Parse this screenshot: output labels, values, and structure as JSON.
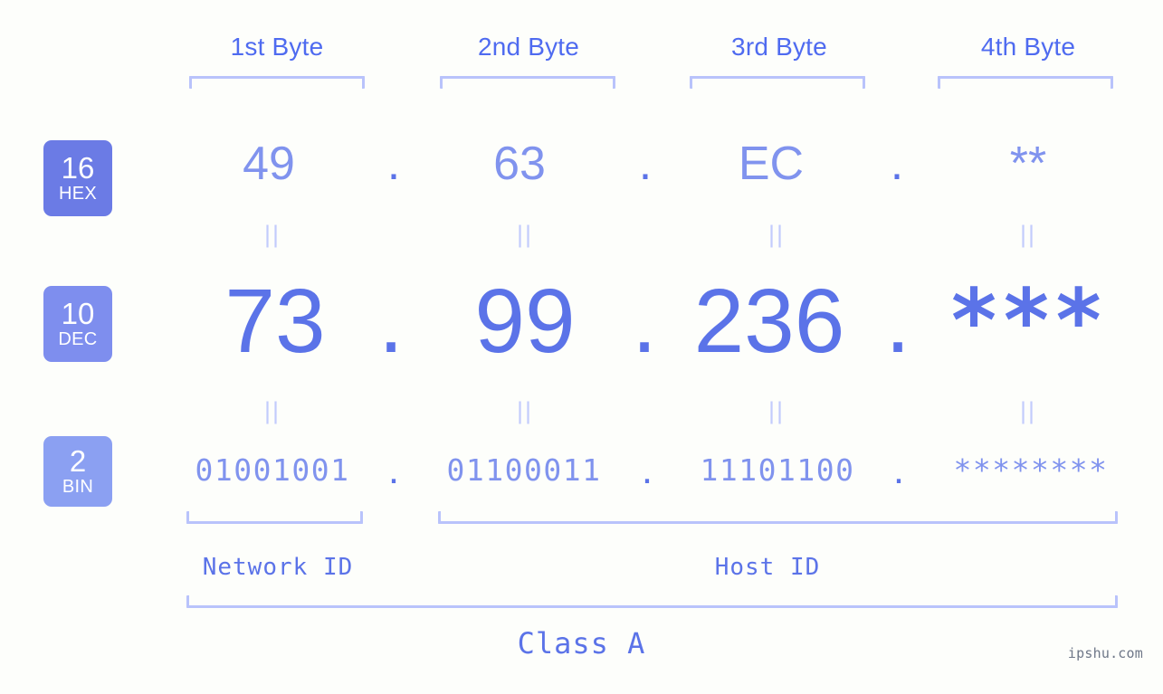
{
  "page": {
    "background_color": "#fdfefb",
    "accent_color": "#5b73e8",
    "accent_light_color": "#8093ee",
    "bracket_color": "#b9c3fb",
    "watermark": "ipshu.com"
  },
  "byte_headers": [
    {
      "label": "1st Byte"
    },
    {
      "label": "2nd Byte"
    },
    {
      "label": "3rd Byte"
    },
    {
      "label": "4th Byte"
    }
  ],
  "bases": [
    {
      "id": "hex",
      "number": "16",
      "name": "HEX",
      "badge_color": "#6b7be5"
    },
    {
      "id": "dec",
      "number": "10",
      "name": "DEC",
      "badge_color": "#7e8eee"
    },
    {
      "id": "bin",
      "number": "2",
      "name": "BIN",
      "badge_color": "#8ba0f2"
    }
  ],
  "rows": {
    "hex": {
      "values": [
        "49",
        "63",
        "EC",
        "**"
      ],
      "separators": [
        ".",
        ".",
        "."
      ]
    },
    "dec": {
      "values": [
        "73",
        "99",
        "236",
        "***"
      ],
      "separators": [
        ".",
        ".",
        "."
      ]
    },
    "bin": {
      "values": [
        "01001001",
        "01100011",
        "11101100",
        "********"
      ],
      "separators": [
        ".",
        ".",
        "."
      ]
    }
  },
  "equals_marks": {
    "glyph": "||",
    "hex_to_dec_count": 4,
    "dec_to_bin_count": 4
  },
  "segments": {
    "network_id": {
      "label": "Network ID"
    },
    "host_id": {
      "label": "Host ID"
    },
    "class": {
      "label": "Class A"
    }
  }
}
